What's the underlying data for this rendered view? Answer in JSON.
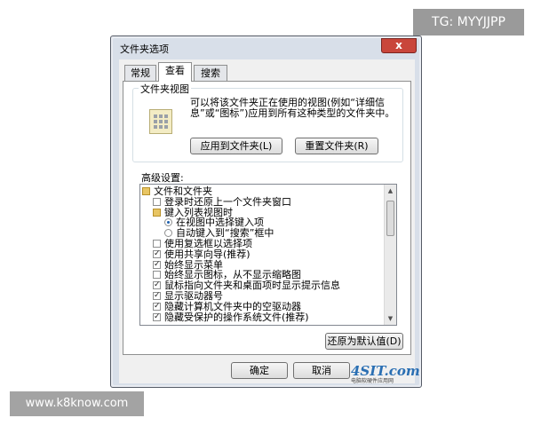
{
  "watermarks": {
    "tg": "TG: MYYJJPP",
    "site": "www.k8know.com"
  },
  "dialog": {
    "title": "文件夹选项",
    "close_glyph": "x"
  },
  "tabs": [
    "常规",
    "查看",
    "搜索"
  ],
  "active_tab": "查看",
  "folder_views": {
    "heading": "文件夹视图",
    "description": "可以将该文件夹正在使用的视图(例如“详细信息”或“图标”)应用到所有这种类型的文件夹中。",
    "apply_button": "应用到文件夹(L)",
    "reset_button": "重置文件夹(R)"
  },
  "advanced": {
    "label": "高级设置:",
    "items": [
      {
        "type": "folder",
        "label": "文件和文件夹",
        "indent": 0
      },
      {
        "type": "checkbox",
        "label": "登录时还原上一个文件夹窗口",
        "checked": false,
        "indent": 1
      },
      {
        "type": "folder",
        "label": "键入列表视图时",
        "indent": 1
      },
      {
        "type": "radio",
        "label": "在视图中选择键入项",
        "checked": true,
        "indent": 2
      },
      {
        "type": "radio",
        "label": "自动键入到“搜索”框中",
        "checked": false,
        "indent": 2
      },
      {
        "type": "checkbox",
        "label": "使用复选框以选择项",
        "checked": false,
        "indent": 1
      },
      {
        "type": "checkbox",
        "label": "使用共享向导(推荐)",
        "checked": true,
        "indent": 1
      },
      {
        "type": "checkbox",
        "label": "始终显示菜单",
        "checked": true,
        "indent": 1
      },
      {
        "type": "checkbox",
        "label": "始终显示图标，从不显示缩略图",
        "checked": false,
        "indent": 1
      },
      {
        "type": "checkbox",
        "label": "鼠标指向文件夹和桌面项时显示提示信息",
        "checked": true,
        "indent": 1
      },
      {
        "type": "checkbox",
        "label": "显示驱动器号",
        "checked": true,
        "indent": 1
      },
      {
        "type": "checkbox",
        "label": "隐藏计算机文件夹中的空驱动器",
        "checked": true,
        "indent": 1
      },
      {
        "type": "checkbox",
        "label": "隐藏受保护的操作系统文件(推荐)",
        "checked": true,
        "indent": 1
      }
    ],
    "restore_button": "还原为默认值(D)"
  },
  "footer": {
    "ok": "确定",
    "cancel": "取消"
  },
  "logo": {
    "text": "4SIT.com",
    "subtext": "电脑软硬件应用网"
  }
}
